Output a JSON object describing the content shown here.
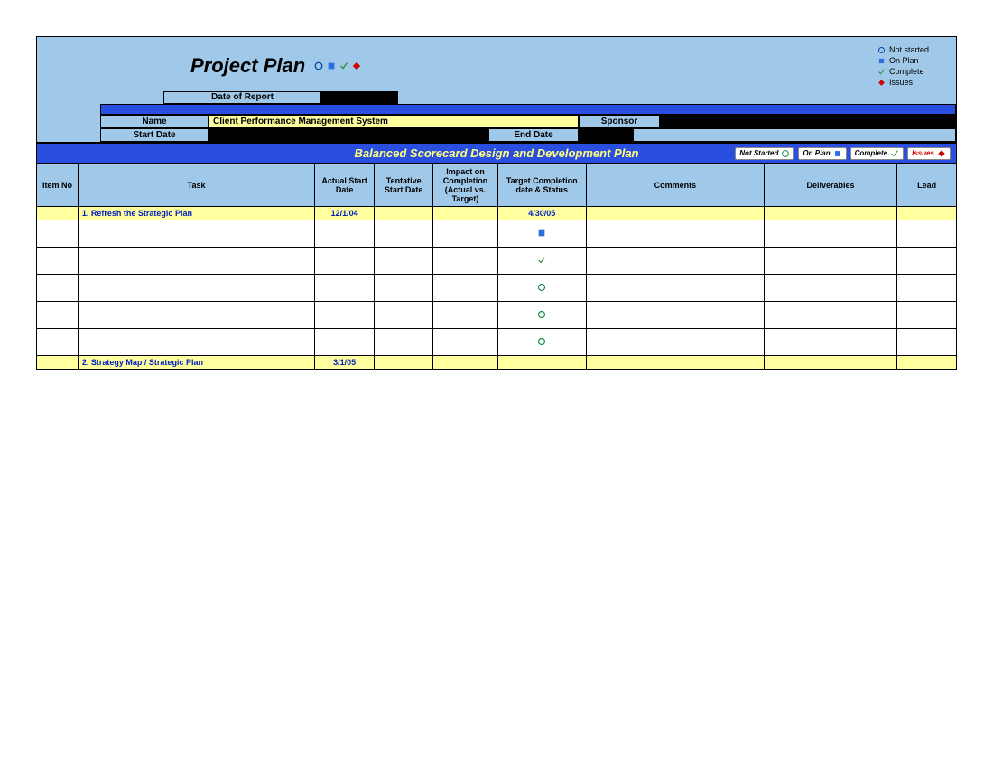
{
  "header": {
    "title": "Project Plan",
    "legend": {
      "not_started": "Not started",
      "on_plan": "On Plan",
      "complete": "Complete",
      "issues": "Issues"
    },
    "date_of_report_label": "Date of Report",
    "name_label": "Name",
    "name_value": "Client Performance Management System",
    "sponsor_label": "Sponsor",
    "start_date_label": "Start Date",
    "end_date_label": "End Date"
  },
  "section_title": "Balanced Scorecard Design and Development Plan",
  "status_buttons": {
    "not_started": "Not Started",
    "on_plan": "On Plan",
    "complete": "Complete",
    "issues": "Issues"
  },
  "columns": {
    "item_no": "Item No",
    "task": "Task",
    "actual_start": "Actual Start Date",
    "tentative_start": "Tentative Start Date",
    "impact": "Impact on Completion (Actual vs. Target)",
    "target_completion": "Target Completion date & Status",
    "comments": "Comments",
    "deliverables": "Deliverables",
    "lead": "Lead"
  },
  "rows": [
    {
      "type": "section",
      "task": "1. Refresh the Strategic Plan",
      "actual_start": "12/1/04",
      "target": "4/30/05"
    },
    {
      "type": "data",
      "status_icon": "on_plan"
    },
    {
      "type": "data",
      "status_icon": "complete"
    },
    {
      "type": "data",
      "status_icon": "not_started"
    },
    {
      "type": "data",
      "status_icon": "not_started"
    },
    {
      "type": "data",
      "status_icon": "not_started"
    },
    {
      "type": "section",
      "task": "2. Strategy Map / Strategic Plan",
      "actual_start": "3/1/05",
      "target": ""
    }
  ]
}
